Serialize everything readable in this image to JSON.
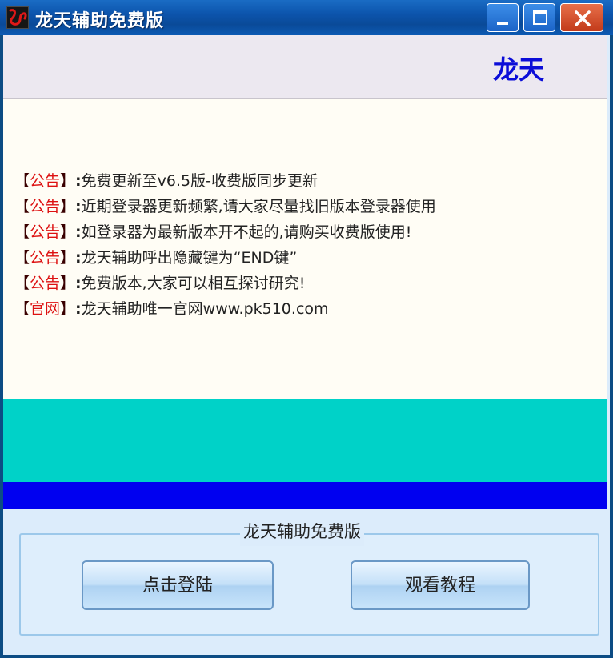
{
  "window": {
    "title": "龙天辅助免费版",
    "colors": {
      "titlebar": "#0c54ac",
      "close": "#c23a1a",
      "frame": "#0c4c84"
    }
  },
  "header": {
    "brand": "龙天",
    "brand_color": "#0b0dd8"
  },
  "notices": [
    {
      "tag": "公告",
      "text": "免费更新至v6.5版-收费版同步更新"
    },
    {
      "tag": "公告",
      "text": "近期登录器更新频繁,请大家尽量找旧版本登录器使用"
    },
    {
      "tag": "公告",
      "text": "如登录器为最新版本开不起的,请购买收费版使用!"
    },
    {
      "tag": "公告",
      "text": "龙天辅助呼出隐藏键为“END键”"
    },
    {
      "tag": "公告",
      "text": "免费版本,大家可以相互探讨研究!"
    },
    {
      "tag": "官网",
      "text": "龙天辅助唯一官网www.pk510.com"
    }
  ],
  "notice_brackets": {
    "open": "【",
    "close": "】",
    "colon": ":"
  },
  "colors": {
    "tag": "#dd1111",
    "cyan_band": "#00d2c8",
    "blue_band": "#0000f0"
  },
  "group": {
    "title": "龙天辅助免费版",
    "login_label": "点击登陆",
    "tutorial_label": "观看教程"
  },
  "icons": [
    "app-icon",
    "minimize-icon",
    "maximize-icon",
    "close-icon"
  ]
}
